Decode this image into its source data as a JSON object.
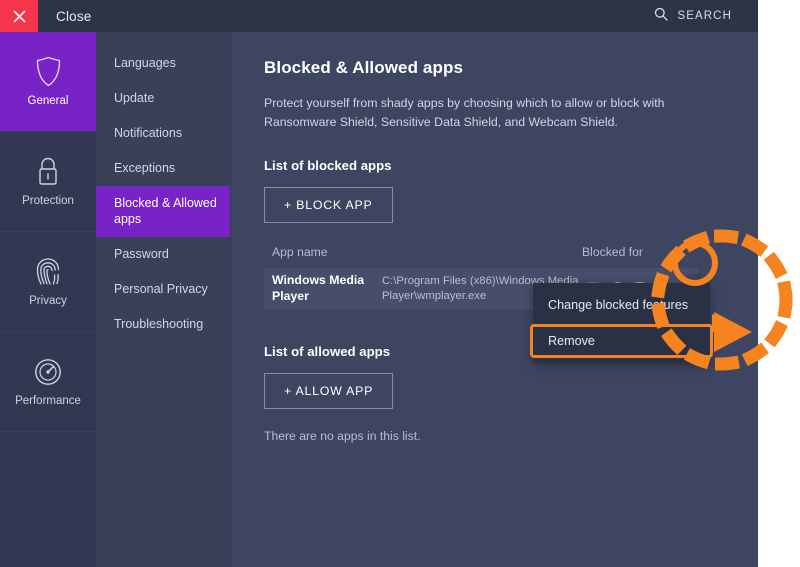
{
  "window": {
    "close_label": "Close",
    "close_icon": "close-x-icon",
    "search_label": "SEARCH",
    "search_icon": "search-icon"
  },
  "primary_nav": {
    "items": [
      {
        "label": "General",
        "icon": "shield-icon",
        "active": true
      },
      {
        "label": "Protection",
        "icon": "lock-icon",
        "active": false
      },
      {
        "label": "Privacy",
        "icon": "fingerprint-icon",
        "active": false
      },
      {
        "label": "Performance",
        "icon": "gauge-icon",
        "active": false
      }
    ]
  },
  "secondary_nav": {
    "items": [
      {
        "label": "Languages",
        "active": false
      },
      {
        "label": "Update",
        "active": false
      },
      {
        "label": "Notifications",
        "active": false
      },
      {
        "label": "Exceptions",
        "active": false
      },
      {
        "label": "Blocked & Allowed apps",
        "active": true
      },
      {
        "label": "Password",
        "active": false
      },
      {
        "label": "Personal Privacy",
        "active": false
      },
      {
        "label": "Troubleshooting",
        "active": false
      }
    ]
  },
  "main": {
    "title": "Blocked & Allowed apps",
    "description": "Protect yourself from shady apps by choosing which to allow or block with Ransomware Shield, Sensitive Data Shield, and Webcam Shield.",
    "blocked_section": {
      "title": "List of blocked apps",
      "add_button": "+ BLOCK APP",
      "columns": {
        "app_name": "App name",
        "blocked_for": "Blocked for"
      },
      "rows": [
        {
          "name": "Windows Media Player",
          "path": "C:\\Program Files (x86)\\Windows Media Player\\wmplayer.exe",
          "blocked_for_icons": [
            "laptop-shield-icon",
            "webcam-icon",
            "sensitive-data-shield-icon",
            "card-key-icon"
          ],
          "menu_icon": "ellipsis-icon"
        }
      ]
    },
    "allowed_section": {
      "title": "List of allowed apps",
      "add_button": "+ ALLOW APP",
      "empty_message": "There are no apps in this list."
    }
  },
  "context_menu": {
    "items": [
      {
        "label": "Change blocked features",
        "highlighted": false
      },
      {
        "label": "Remove",
        "highlighted": true
      }
    ]
  },
  "colors": {
    "accent_purple": "#7823c6",
    "close_red": "#f4364c",
    "annotation_orange": "#f5831f",
    "window_bg": "#3e4560",
    "titlebar_bg": "#2e3447",
    "row_bg": "#474e6b",
    "menu_bg": "#2b3145"
  }
}
